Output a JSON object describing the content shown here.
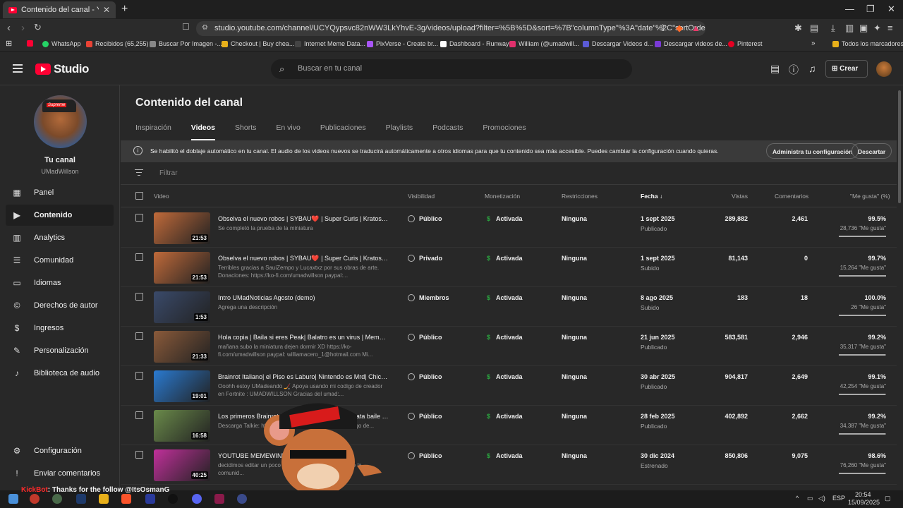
{
  "browser": {
    "tab_title": "Contenido del canal - YouTube S",
    "url": "studio.youtube.com/channel/UCYQypsvc82nWW3LkYhvE-3g/videos/upload?filter=%5B%5D&sort=%7B\"columnType\"%3A\"date\"%2C\"sortOrder\"%3A...",
    "bookmarks": [
      "WhatsApp",
      "Recibidos (65,255)",
      "Buscar Por Imagen -...",
      "Checkout | Buy chea...",
      "Internet Meme Data...",
      "PixVerse - Create br...",
      "Dashboard - Runway",
      "William (@umadwill...",
      "Descargar Videos d...",
      "Descargar videos de...",
      "Pinterest"
    ],
    "bookmarks_folder": "Todos los marcadores"
  },
  "header": {
    "logo_text": "Studio",
    "search_placeholder": "Buscar en tu canal",
    "create_label": "Crear"
  },
  "sidebar": {
    "channel_title": "Tu canal",
    "channel_handle": "UMadWillson",
    "items": [
      {
        "label": "Panel",
        "icon": "dashboard-icon"
      },
      {
        "label": "Contenido",
        "icon": "content-icon"
      },
      {
        "label": "Analytics",
        "icon": "analytics-icon"
      },
      {
        "label": "Comunidad",
        "icon": "community-icon"
      },
      {
        "label": "Idiomas",
        "icon": "subtitles-icon"
      },
      {
        "label": "Derechos de autor",
        "icon": "copyright-icon"
      },
      {
        "label": "Ingresos",
        "icon": "dollar-icon"
      },
      {
        "label": "Personalización",
        "icon": "magic-wand-icon"
      },
      {
        "label": "Biblioteca de audio",
        "icon": "audio-library-icon"
      }
    ],
    "bottom": [
      {
        "label": "Configuración",
        "icon": "gear-icon"
      },
      {
        "label": "Enviar comentarios",
        "icon": "feedback-icon"
      }
    ]
  },
  "main": {
    "title": "Contenido del canal",
    "tabs": [
      "Inspiración",
      "Videos",
      "Shorts",
      "En vivo",
      "Publicaciones",
      "Playlists",
      "Podcasts",
      "Promociones"
    ],
    "active_tab": "Videos",
    "banner": {
      "text": "Se habilitó el doblaje automático en tu canal. El audio de los videos nuevos se traducirá automáticamente a otros idiomas para que tu contenido sea más accesible. Puedes cambiar la configuración cuando quieras.",
      "manage_label": "Administra tu configuración",
      "dismiss_label": "Descartar"
    },
    "filter_placeholder": "Filtrar",
    "columns": [
      "Video",
      "Visibilidad",
      "Monetización",
      "Restricciones",
      "Fecha",
      "Vistas",
      "Comentarios",
      "\"Me gusta\" (%)"
    ],
    "rows": [
      {
        "title": "Obselva el nuevo robos | SYBAU❤️ | Super Curis | Kratos en t...",
        "desc": "Se completó la prueba de la miniatura",
        "duration": "21:53",
        "visibility": "Público",
        "monetization": "Activada",
        "restrictions": "Ninguna",
        "date": "1 sept 2025",
        "date_status": "Publicado",
        "views": "289,882",
        "comments": "2,461",
        "likes_pct": "99.5%",
        "likes": "28,736 \"Me gusta\"",
        "fill": 0.995,
        "thumb": "#c06a3a"
      },
      {
        "title": "Obselva el nuevo robos | SYBAU❤️ | Super Curis | Kratos en t...",
        "desc": "Terribles gracias a SauiZempo y Lucaxtxz por sus obras de arte. Donaciones: https://ko-fi.com/umadwillson paypal:...",
        "duration": "21:53",
        "visibility": "Privado",
        "monetization": "Activada",
        "restrictions": "Ninguna",
        "date": "1 sept 2025",
        "date_status": "Subido",
        "views": "81,143",
        "comments": "0",
        "likes_pct": "99.7%",
        "likes": "15,264 \"Me gusta\"",
        "fill": 0.997,
        "thumb": "#c06a3a"
      },
      {
        "title": "Intro UMadNoticias Agosto (demo)",
        "desc": "Agrega una descripción",
        "duration": "1:53",
        "visibility": "Miembros",
        "monetization": "Activada",
        "restrictions": "Ninguna",
        "date": "8 ago 2025",
        "date_status": "Subido",
        "views": "183",
        "comments": "18",
        "likes_pct": "100.0%",
        "likes": "26 \"Me gusta\"",
        "fill": 1.0,
        "thumb": "#3a4a6a"
      },
      {
        "title": "Hola copia | Baila si eres Peak| Balatro es un virus | Memes C...",
        "desc": "mañana subo la miniatura dejen dormir XD https://ko-fi.com/umadwillson paypal: williamacero_1@hotmail.com Mi...",
        "duration": "21:33",
        "visibility": "Público",
        "monetization": "Activada",
        "restrictions": "Ninguna",
        "date": "21 jun 2025",
        "date_status": "Publicado",
        "views": "583,581",
        "comments": "2,946",
        "likes_pct": "99.2%",
        "likes": "35,317 \"Me gusta\"",
        "fill": 0.992,
        "thumb": "#8a5a3a"
      },
      {
        "title": "Brainrot Italiano| el Piso es Laburo| Nintendo es Mrd| Chicken...",
        "desc": "Ooohh estoy UMadeando 🏒 Apoya usando mi codigo de creador en Fortnite : UMADWILLSON Gracias del umad:...",
        "duration": "19:01",
        "visibility": "Público",
        "monetization": "Activada",
        "restrictions": "Ninguna",
        "date": "30 abr 2025",
        "date_status": "Publicado",
        "views": "904,817",
        "comments": "2,649",
        "likes_pct": "99.1%",
        "likes": "42,254 \"Me gusta\"",
        "fill": 0.991,
        "thumb": "#2a7ad0"
      },
      {
        "title": "Los primeros Brainrot | Skibidi Toilet | Gambol | Rata baile | ...",
        "desc": "Descarga Talkie: https://talkie-ai.onelink.me/P... mi codigo de...",
        "duration": "16:58",
        "visibility": "Público",
        "monetization": "Activada",
        "restrictions": "Ninguna",
        "date": "28 feb 2025",
        "date_status": "Publicado",
        "views": "402,892",
        "comments": "2,662",
        "likes_pct": "99.2%",
        "likes": "34,387 \"Me gusta\"",
        "fill": 0.992,
        "thumb": "#6a8a4a"
      },
      {
        "title": "YOUTUBE MEMEWIND 2024",
        "desc": "decidimos editar un poco , no s... a 40 otro año mas de la comunid...",
        "duration": "40:25",
        "visibility": "Público",
        "monetization": "Activada",
        "restrictions": "Ninguna",
        "date": "30 dic 2024",
        "date_status": "Estrenado",
        "views": "850,806",
        "comments": "9,075",
        "likes_pct": "98.6%",
        "likes": "76,260 \"Me gusta\"",
        "fill": 0.986,
        "thumb": "#c0309a"
      }
    ]
  },
  "overlay": {
    "chat_user": "KickBot",
    "chat_message": ": Thanks for the follow @ItsOsmanG",
    "cap_text": "Supreme"
  },
  "taskbar": {
    "lang": "ESP",
    "time": "20:54",
    "date": "15/09/2025"
  }
}
